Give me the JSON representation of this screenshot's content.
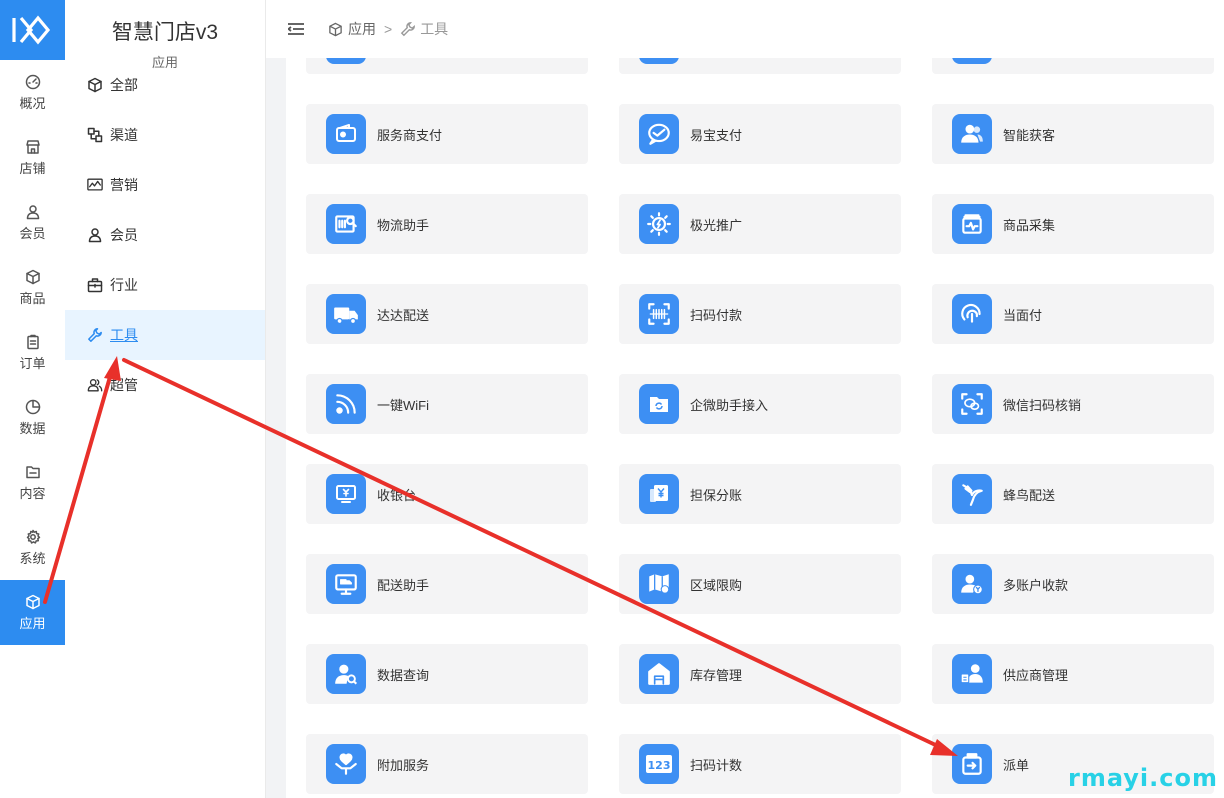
{
  "rail": {
    "items": [
      {
        "label": "概况",
        "icon": "dashboard-icon"
      },
      {
        "label": "店铺",
        "icon": "store-icon"
      },
      {
        "label": "会员",
        "icon": "user-icon"
      },
      {
        "label": "商品",
        "icon": "cube-icon"
      },
      {
        "label": "订单",
        "icon": "clipboard-icon"
      },
      {
        "label": "数据",
        "icon": "pie-chart-icon"
      },
      {
        "label": "内容",
        "icon": "folder-icon"
      },
      {
        "label": "系统",
        "icon": "gear-icon"
      },
      {
        "label": "应用",
        "icon": "cube-icon"
      }
    ],
    "active_index": 8
  },
  "subnav": {
    "title": "智慧门店v3",
    "subtitle": "应用",
    "items": [
      {
        "label": "全部",
        "icon": "cube-icon"
      },
      {
        "label": "渠道",
        "icon": "channel-icon"
      },
      {
        "label": "营销",
        "icon": "trend-chart-icon"
      },
      {
        "label": "会员",
        "icon": "user-icon"
      },
      {
        "label": "行业",
        "icon": "briefcase-icon"
      },
      {
        "label": "工具",
        "icon": "wrench-icon"
      },
      {
        "label": "超管",
        "icon": "users-icon"
      }
    ],
    "active_index": 5
  },
  "header": {
    "breadcrumb": [
      {
        "label": "应用",
        "icon": "cube-icon"
      },
      {
        "label": "工具",
        "icon": "wrench-icon"
      }
    ],
    "separator": ">"
  },
  "tools": [
    {
      "label": "",
      "icon": "blank-icon"
    },
    {
      "label": "",
      "icon": "blank-icon"
    },
    {
      "label": "",
      "icon": "blank-icon"
    },
    {
      "label": "服务商支付",
      "icon": "wallet-icon"
    },
    {
      "label": "易宝支付",
      "icon": "chat-check-icon"
    },
    {
      "label": "智能获客",
      "icon": "users-icon"
    },
    {
      "label": "物流助手",
      "icon": "barcode-search-icon"
    },
    {
      "label": "极光推广",
      "icon": "sun-bolt-icon"
    },
    {
      "label": "商品采集",
      "icon": "box-pulse-icon"
    },
    {
      "label": "达达配送",
      "icon": "truck-icon"
    },
    {
      "label": "扫码付款",
      "icon": "scan-barcode-icon"
    },
    {
      "label": "当面付",
      "icon": "fingerprint-icon"
    },
    {
      "label": "一键WiFi",
      "icon": "wifi-icon"
    },
    {
      "label": "企微助手接入",
      "icon": "folder-sync-icon"
    },
    {
      "label": "微信扫码核销",
      "icon": "wechat-scan-icon"
    },
    {
      "label": "收银台",
      "icon": "cashier-icon"
    },
    {
      "label": "担保分账",
      "icon": "yen-card-icon"
    },
    {
      "label": "蜂鸟配送",
      "icon": "hummingbird-icon"
    },
    {
      "label": "配送助手",
      "icon": "monitor-truck-icon"
    },
    {
      "label": "区域限购",
      "icon": "map-icon"
    },
    {
      "label": "多账户收款",
      "icon": "user-yen-icon"
    },
    {
      "label": "数据查询",
      "icon": "user-search-icon"
    },
    {
      "label": "库存管理",
      "icon": "warehouse-icon"
    },
    {
      "label": "供应商管理",
      "icon": "supplier-icon"
    },
    {
      "label": "附加服务",
      "icon": "heart-hands-icon"
    },
    {
      "label": "扫码计数",
      "icon": "counter-123-icon"
    },
    {
      "label": "派单",
      "icon": "dispatch-icon"
    }
  ],
  "counter_text": "123",
  "colors": {
    "primary": "#2d8cf0",
    "tile_icon": "#3d8ff3",
    "card_bg": "#f4f4f5",
    "annotation_arrow": "#e8302a",
    "watermark": "#28d1e6"
  },
  "watermark": "rmayi.com"
}
